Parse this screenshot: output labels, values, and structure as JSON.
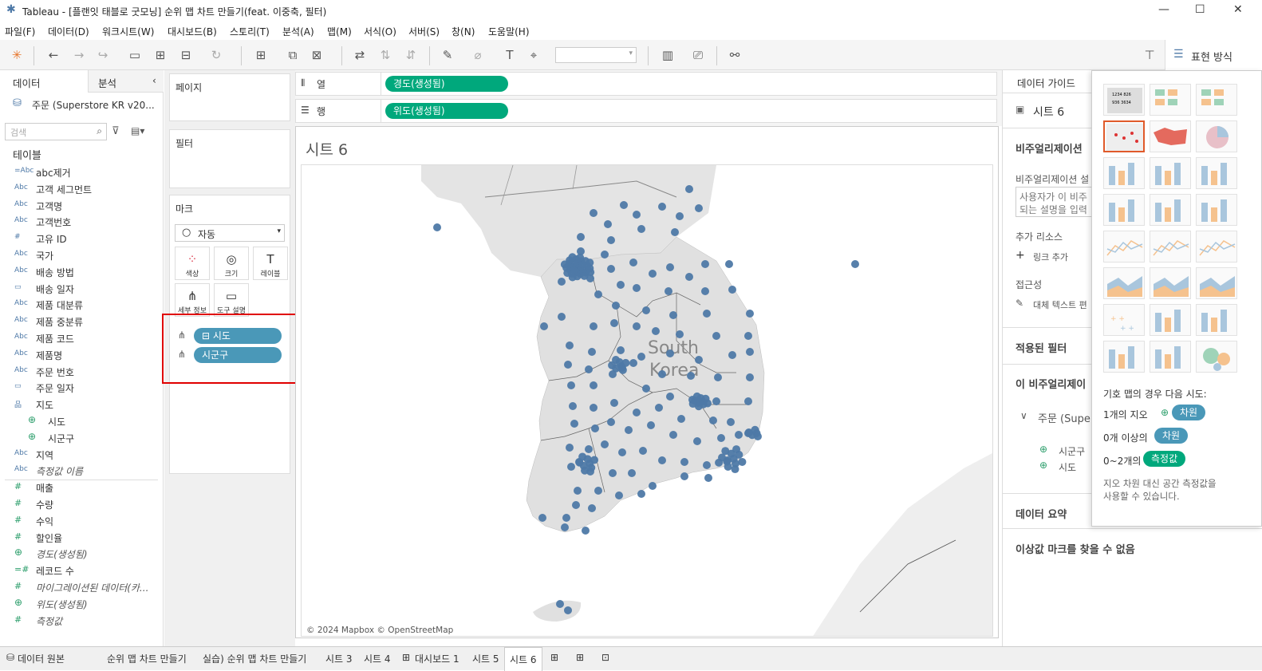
{
  "window": {
    "title": "Tableau - [플랜잇 태블로 굿모닝] 순위 맵 차트 만들기(feat. 이중축, 필터)"
  },
  "menu": [
    "파일(F)",
    "데이터(D)",
    "워크시트(W)",
    "대시보드(B)",
    "스토리(T)",
    "분석(A)",
    "맵(M)",
    "서식(O)",
    "서버(S)",
    "창(N)",
    "도움말(H)"
  ],
  "toolbar": {
    "showme_label": "표현 방식"
  },
  "left": {
    "tab_data": "데이터",
    "tab_analysis": "분석",
    "datasource": "주문 (Superstore KR v20...",
    "search_placeholder": "검색",
    "tables_header": "테이블",
    "fields": [
      {
        "icon": "=Abc",
        "label": "abc제거",
        "italic": false
      },
      {
        "icon": "Abc",
        "label": "고객 세그먼트",
        "italic": false
      },
      {
        "icon": "Abc",
        "label": "고객명",
        "italic": false
      },
      {
        "icon": "Abc",
        "label": "고객번호",
        "italic": false
      },
      {
        "icon": "#",
        "label": "고유 ID",
        "italic": false
      },
      {
        "icon": "Abc",
        "label": "국가",
        "italic": false
      },
      {
        "icon": "Abc",
        "label": "배송 방법",
        "italic": false
      },
      {
        "icon": "▭",
        "label": "배송 일자",
        "italic": false
      },
      {
        "icon": "Abc",
        "label": "제품 대분류",
        "italic": false
      },
      {
        "icon": "Abc",
        "label": "제품 중분류",
        "italic": false
      },
      {
        "icon": "Abc",
        "label": "제품 코드",
        "italic": false
      },
      {
        "icon": "Abc",
        "label": "제품명",
        "italic": false
      },
      {
        "icon": "Abc",
        "label": "주문 번호",
        "italic": false
      },
      {
        "icon": "▭",
        "label": "주문 일자",
        "italic": false
      },
      {
        "icon": "品",
        "label": "지도",
        "italic": false
      },
      {
        "icon": "⊕",
        "label": "시도",
        "italic": false,
        "sub": true
      },
      {
        "icon": "⊕",
        "label": "시군구",
        "italic": false,
        "sub": true
      },
      {
        "icon": "Abc",
        "label": "지역",
        "italic": false
      },
      {
        "icon": "Abc",
        "label": "측정값 이름",
        "italic": true
      },
      {
        "icon": "#",
        "label": "매출",
        "italic": false,
        "measure": true
      },
      {
        "icon": "#",
        "label": "수량",
        "italic": false,
        "measure": true
      },
      {
        "icon": "#",
        "label": "수익",
        "italic": false,
        "measure": true
      },
      {
        "icon": "#",
        "label": "할인율",
        "italic": false,
        "measure": true
      },
      {
        "icon": "⊕",
        "label": "경도(생성됨)",
        "italic": true,
        "measure": true
      },
      {
        "icon": "=#",
        "label": "레코드 수",
        "italic": false,
        "measure": true
      },
      {
        "icon": "#",
        "label": "마이그레이션된 데이터(카...",
        "italic": true,
        "measure": true
      },
      {
        "icon": "⊕",
        "label": "위도(생성됨)",
        "italic": true,
        "measure": true
      },
      {
        "icon": "#",
        "label": "측정값",
        "italic": true,
        "measure": true
      }
    ]
  },
  "shelves": {
    "pages": "페이지",
    "filters": "필터",
    "marks": "마크",
    "mark_type": "자동",
    "mark_buttons": [
      "색상",
      "크기",
      "레이블",
      "세부 정보",
      "도구 설명"
    ],
    "mark_pills": [
      "시도",
      "시군구"
    ],
    "columns_label": "열",
    "rows_label": "행",
    "columns_pill": "경도(생성됨)",
    "rows_pill": "위도(생성됨)"
  },
  "viz": {
    "sheet_title": "시트 6",
    "country_label_1": "South",
    "country_label_2": "Korea",
    "attribution": "© 2024 Mapbox © OpenStreetMap",
    "dot_color": "#4e79a7"
  },
  "guide": {
    "title": "데이터 가이드",
    "sheet": "시트 6",
    "viz_desc_header": "비주얼리제이션",
    "viz_desc_sub": "비주얼리제이션 설",
    "placeholder_1": "사용자가 이 비주",
    "placeholder_2": "되는 설명을 입력",
    "resources": "추가 리소스",
    "add_link": "링크 추가",
    "accessibility": "접근성",
    "alt_text": "대체 텍스트 편",
    "filters_applied": "적용된 필터",
    "data_in_viz": "이 비주얼리제이",
    "datasource": "주문 (Supe",
    "field_1": "시군구",
    "field_2": "시도",
    "summary": "데이터 요약",
    "no_outliers": "이상값 마크를 찾을 수 없음"
  },
  "showme": {
    "hint_title": "기호 맵의 경우 다음 시도:",
    "row1_prefix": "1개의 지오",
    "row1_badge": "차원",
    "row2_prefix": "0개 이상의",
    "row2_badge": "차원",
    "row3_prefix": "0~2개의",
    "row3_badge": "측정값",
    "note_1": "지오 차원 대신 공간 측정값을",
    "note_2": "사용할 수 있습니다."
  },
  "bottom_tabs": [
    "데이터 원본",
    "순위 맵 차트 만들기",
    "실습) 순위 맵 차트 만들기",
    "시트 3",
    "시트 4",
    "대시보드 1",
    "시트 5",
    "시트 6"
  ],
  "colors": {
    "green_pill": "#00a87c",
    "blue_pill": "#4a98b8",
    "highlight": "#e00000"
  }
}
